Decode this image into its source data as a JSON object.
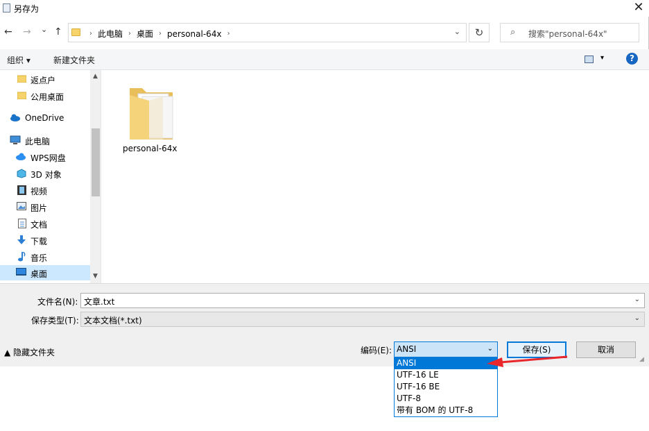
{
  "window": {
    "title": "另存为",
    "close_glyph": "✕"
  },
  "nav_buttons": {
    "back": "←",
    "forward": "→",
    "recent": "⌄",
    "up": "↑"
  },
  "address": {
    "crumbs": [
      "此电脑",
      "桌面",
      "personal-64x"
    ],
    "separator": "›",
    "dropdown": "⌄"
  },
  "refresh": "↻",
  "search": {
    "placeholder": "搜索\"personal-64x\"",
    "icon": "⌕"
  },
  "toolbar": {
    "organize": "组织 ▾",
    "new_folder": "新建文件夹",
    "view_chevron": "▾",
    "help": "?"
  },
  "sidebar": {
    "items": [
      {
        "label": "返点户",
        "icon": "folder-icon"
      },
      {
        "label": "公用桌面",
        "icon": "folder-icon"
      },
      {
        "label": "OneDrive",
        "icon": "cloud-icon"
      },
      {
        "label": "此电脑",
        "icon": "computer-icon"
      },
      {
        "label": "WPS网盘",
        "icon": "cloud-icon"
      },
      {
        "label": "3D 对象",
        "icon": "cube-icon"
      },
      {
        "label": "视频",
        "icon": "film-icon"
      },
      {
        "label": "图片",
        "icon": "picture-icon"
      },
      {
        "label": "文档",
        "icon": "document-icon"
      },
      {
        "label": "下载",
        "icon": "download-icon"
      },
      {
        "label": "音乐",
        "icon": "music-icon"
      },
      {
        "label": "桌面",
        "icon": "desktop-icon",
        "selected": true
      }
    ],
    "scroll_up": "▲",
    "scroll_down": "▼"
  },
  "content": {
    "items": [
      {
        "name": "personal-64x",
        "type": "folder"
      }
    ]
  },
  "form": {
    "filename_label": "文件名(N):",
    "filename_value": "文章.txt",
    "filetype_label": "保存类型(T):",
    "filetype_value": "文本文档(*.txt)",
    "hide_folders": "▲  隐藏文件夹",
    "encoding_label": "编码(E):",
    "encoding_value": "ANSI",
    "save": "保存(S)",
    "cancel": "取消",
    "chevron": "⌄"
  },
  "encoding_options": [
    "ANSI",
    "UTF-16 LE",
    "UTF-16 BE",
    "UTF-8",
    "带有 BOM 的 UTF-8"
  ],
  "colors": {
    "accent": "#0078d7",
    "selection": "#cce8ff",
    "annotation_arrow": "#e8262b"
  }
}
